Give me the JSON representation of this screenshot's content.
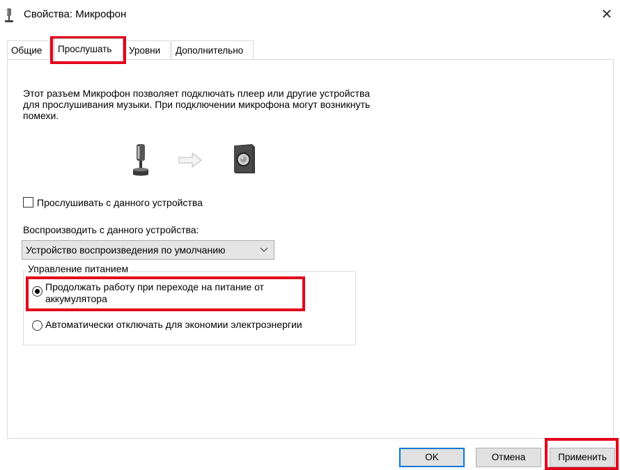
{
  "window": {
    "title": "Свойства: Микрофон",
    "close_glyph": "✕"
  },
  "tabs": [
    {
      "label": "Общие",
      "active": false
    },
    {
      "label": "Прослушать",
      "active": true
    },
    {
      "label": "Уровни",
      "active": false
    },
    {
      "label": "Дополнительно",
      "active": false
    }
  ],
  "listen": {
    "description": "Этот разъем Микрофон позволяет подключать плеер или другие устройства для прослушивания музыки. При подключении микрофона могут возникнуть помехи.",
    "checkbox_label": "Прослушивать с данного устройства",
    "checkbox_checked": false,
    "playback_label": "Воспроизводить с данного устройства:",
    "playback_selected": "Устройство воспроизведения по умолчанию",
    "power_group": {
      "legend": "Управление питанием",
      "options": [
        {
          "label": "Продолжать работу при переходе на питание от аккумулятора",
          "checked": true
        },
        {
          "label": "Автоматически отключать для экономии электроэнергии",
          "checked": false
        }
      ]
    }
  },
  "icons": {
    "title": "microphone-icon",
    "source": "microphone-icon",
    "arrow": "arrow-right-icon",
    "target": "speaker-icon"
  },
  "buttons": {
    "ok": "OK",
    "cancel": "Отмена",
    "apply": "Применить"
  },
  "colors": {
    "highlight": "#e3001b",
    "default_button_border": "#0078d7"
  }
}
